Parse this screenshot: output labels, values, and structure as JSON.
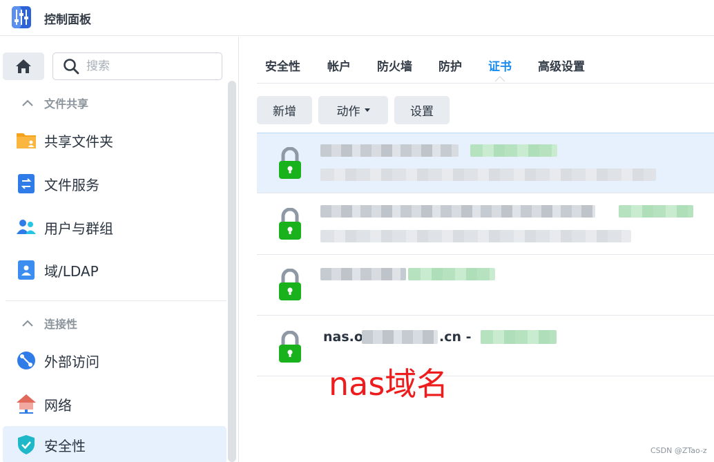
{
  "window": {
    "title": "控制面板"
  },
  "search": {
    "placeholder": "搜索"
  },
  "sidebar": {
    "sections": [
      {
        "header": "文件共享",
        "items": [
          {
            "label": "共享文件夹",
            "icon": "folder-share-icon"
          },
          {
            "label": "文件服务",
            "icon": "file-services-icon"
          },
          {
            "label": "用户与群组",
            "icon": "users-groups-icon"
          },
          {
            "label": "域/LDAP",
            "icon": "domain-ldap-icon"
          }
        ]
      },
      {
        "header": "连接性",
        "items": [
          {
            "label": "外部访问",
            "icon": "external-access-icon"
          },
          {
            "label": "网络",
            "icon": "network-icon"
          },
          {
            "label": "安全性",
            "icon": "security-shield-icon",
            "active": true
          }
        ]
      }
    ]
  },
  "tabs": [
    {
      "label": "安全性"
    },
    {
      "label": "帐户"
    },
    {
      "label": "防火墙"
    },
    {
      "label": "防护"
    },
    {
      "label": "证书",
      "active": true
    },
    {
      "label": "高级设置"
    }
  ],
  "toolbar": {
    "add_label": "新增",
    "action_label": "动作",
    "settings_label": "设置"
  },
  "certificates": {
    "rows": [
      {
        "name_visible": "",
        "redacted": true,
        "selected": true
      },
      {
        "name_visible": "",
        "redacted": true
      },
      {
        "name_visible": "",
        "redacted": true
      },
      {
        "name_prefix": "nas.o",
        "name_suffix": ".cn -",
        "redacted_partial": true
      }
    ]
  },
  "annotation": {
    "text": "nas域名"
  },
  "watermark": {
    "text": "CSDN @ZTao-z"
  },
  "colors": {
    "accent": "#1a8cf0",
    "lock_green": "#19b21c",
    "lock_gray": "#8e99a5",
    "annotation_red": "#ee1c1c",
    "selected_row": "#e6f1fd"
  }
}
